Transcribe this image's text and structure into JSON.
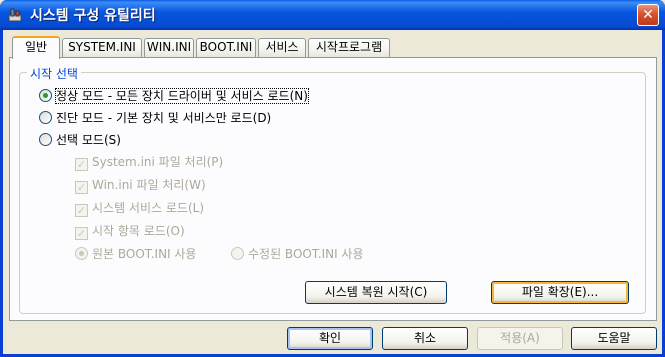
{
  "window": {
    "title": "시스템 구성 유틸리티",
    "close": "✕"
  },
  "tabs": [
    "일반",
    "SYSTEM.INI",
    "WIN.INI",
    "BOOT.INI",
    "서비스",
    "시작프로그램"
  ],
  "startup": {
    "group_title": "시작 선택",
    "normal": "정상 모드 - 모든 장치 드라이버 및 서비스 로드(N)",
    "diagnostic": "진단 모드 - 기본 장치 및 서비스만 로드(D)",
    "selective": "선택 모드(S)",
    "process_system_ini": "System.ini 파일 처리(P)",
    "process_win_ini": "Win.ini 파일 처리(W)",
    "load_services": "시스템 서비스 로드(L)",
    "load_startup": "시작 항목 로드(O)",
    "use_original_boot": "원본 BOOT.INI 사용",
    "use_modified_boot": "수정된 BOOT.INI 사용",
    "selected_mode": "normal"
  },
  "panel_buttons": {
    "restore": "시스템 복원 시작(C)",
    "expand": "파일 확장(E)..."
  },
  "dialog_buttons": {
    "ok": "확인",
    "cancel": "취소",
    "apply": "적용(A)",
    "help": "도움말"
  }
}
